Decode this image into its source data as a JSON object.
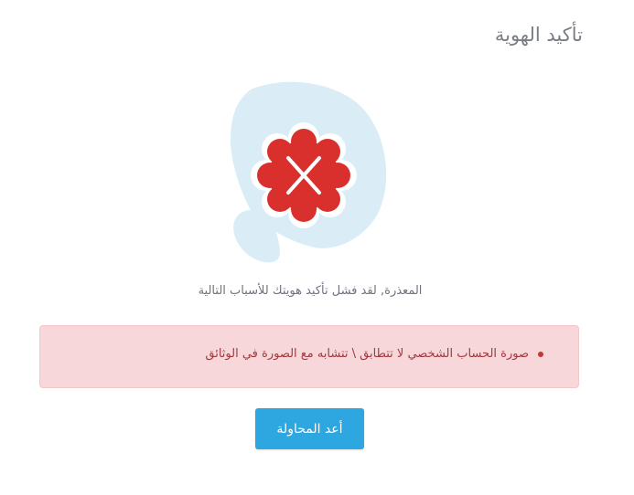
{
  "page": {
    "title": "تأكيد الهوية"
  },
  "illustration": {
    "icon": "error-x-badge-icon",
    "blob_color": "#daedf7",
    "badge_color": "#d9302e"
  },
  "result": {
    "message": "المعذرة, لقد فشل تأكيد هويتك للأسباب التالية"
  },
  "alert": {
    "items": [
      "صورة الحساب الشخصي لا تتطابق \\ تتشابه مع الصورة في الوثائق"
    ]
  },
  "actions": {
    "retry_label": "أعد المحاولة"
  },
  "colors": {
    "accent": "#2ea6e0",
    "alert_bg": "#f8d7da",
    "alert_text": "#a2393f"
  }
}
